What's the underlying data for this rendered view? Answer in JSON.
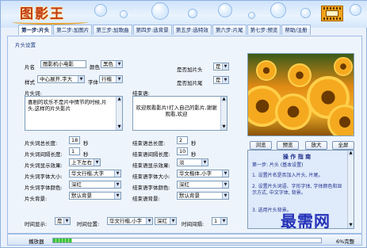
{
  "header": {
    "logo_text": "图影王"
  },
  "tabs": [
    {
      "label": "第一步:片头",
      "active": true
    },
    {
      "label": "第二步:加图片"
    },
    {
      "label": "第三步:加歌曲"
    },
    {
      "label": "第四步:选背景"
    },
    {
      "label": "第五步:选特效"
    },
    {
      "label": "第六步:片尾"
    },
    {
      "label": "第七步:预览"
    },
    {
      "label": "帮助/注册"
    }
  ],
  "section_title": "片头设置",
  "form": {
    "title_label": "片名",
    "title_value": "图影机小电影",
    "color_label": "颜色",
    "color_value": "黑色",
    "add_header_label": "是否加片头",
    "add_header_value": "是",
    "style_label": "样式",
    "style_value": "中心展开,字大",
    "font_label": "字体",
    "font_value": "行楷",
    "add_footer_label": "是否加片尾",
    "add_footer_value": "是",
    "header_text_label": "片头词:",
    "header_text": "喜剧的欢乐不是片中情节的时候,片头,这样的片头影片",
    "footer_text_label": "结束语:",
    "footer_text": "欢迎观看影片!打入自己的影片,谢谢观看,欢迎",
    "left_rows": [
      {
        "label": "片头词总长度:",
        "value": "18",
        "unit": "秒",
        "type": "field"
      },
      {
        "label": "片头词间隔长度:",
        "value": "1",
        "unit": "秒",
        "type": "field"
      },
      {
        "label": "片头词显示效果:",
        "value": "上下左右",
        "type": "select"
      },
      {
        "label": "片头词字体大小:",
        "value": "华文行楷,大字",
        "type": "select"
      },
      {
        "label": "片头词字体颜色:",
        "value": "深红",
        "type": "select"
      },
      {
        "label": "片头背景:",
        "value": "默认背景",
        "type": "select"
      }
    ],
    "right_rows": [
      {
        "label": "结束语总长度:",
        "value": "2",
        "unit": "秒",
        "type": "field"
      },
      {
        "label": "结束语间隔长度:",
        "value": "10",
        "unit": "秒",
        "type": "field"
      },
      {
        "label": "结束语显示效果:",
        "value": "淡",
        "type": "select"
      },
      {
        "label": "结束语字体大小:",
        "value": "华文楷体,小字",
        "type": "select"
      },
      {
        "label": "结束语字体颜色:",
        "value": "深红",
        "type": "select"
      },
      {
        "label": "结束语背景:",
        "value": "默认背景",
        "type": "select"
      }
    ],
    "bottom": {
      "time_display_label": "时间显示:",
      "time_display_value": "是",
      "time_position_label": "时间位置:",
      "time_font_value": "华文行楷,小字",
      "time_color_value": "深红",
      "time_interval_label": "时间间隔:",
      "time_interval_value": "1"
    }
  },
  "preview_buttons": [
    "浏览",
    "预览",
    "放大",
    "全屏"
  ],
  "help": {
    "title": "操 作 指 南",
    "lines": [
      "第一步: 片头 (基本设置)",
      "1. 设置片名是否加入片头, 片尾。",
      "2. 设置片头词语、字形字体, 字体颜色和显示方式, 中文字体, 背景。",
      "3. 选用片头背景。"
    ]
  },
  "watermark_text": "最需网",
  "status": {
    "label": "播放器",
    "progress_fraction": 0.07,
    "right_text": "6%完整"
  }
}
